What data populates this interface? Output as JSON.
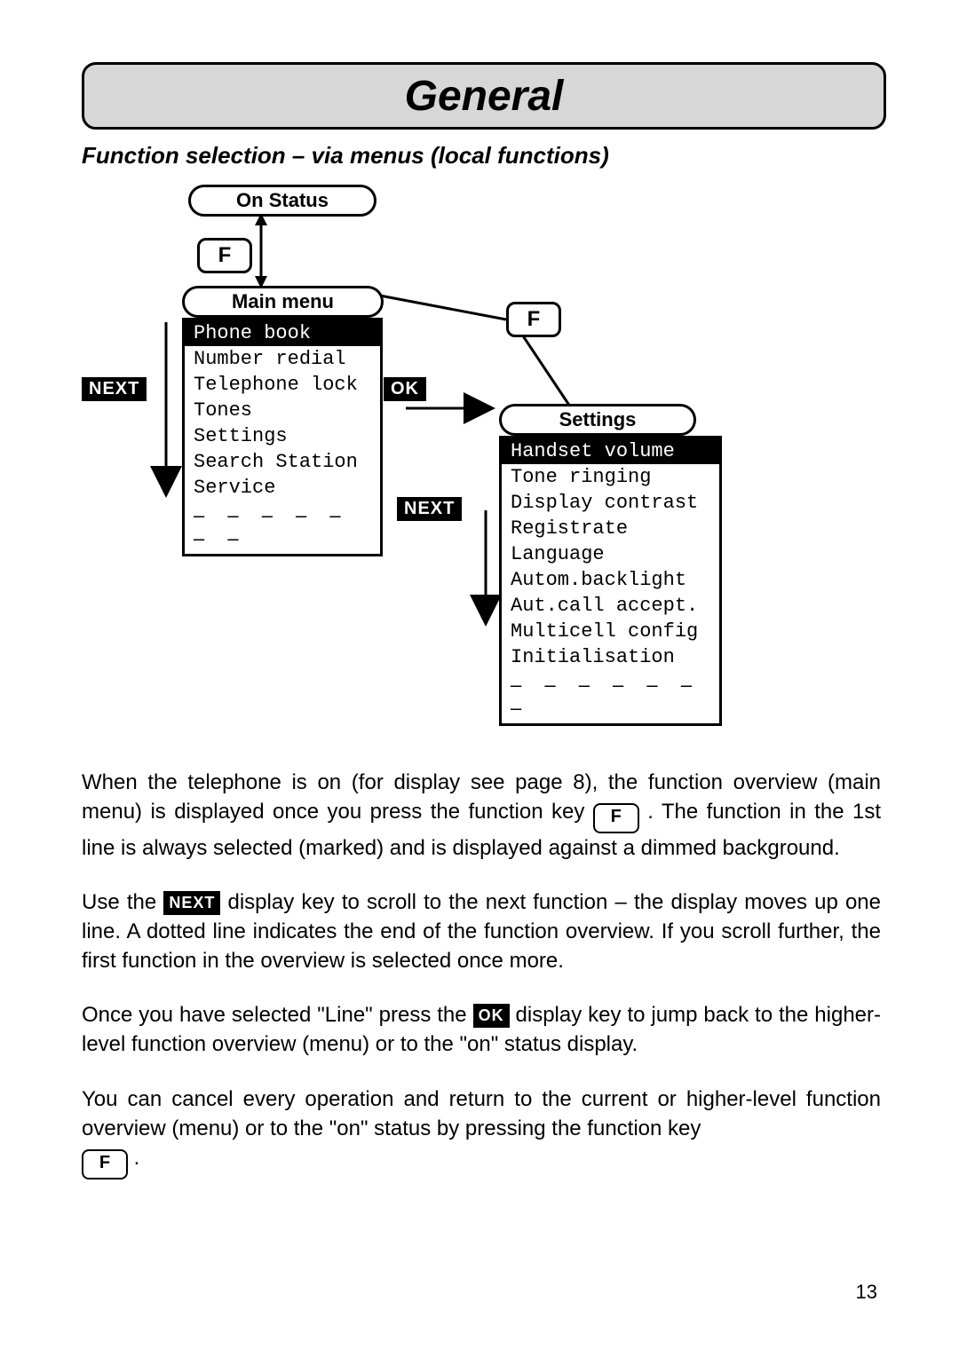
{
  "banner": {
    "title": "General"
  },
  "section_title": "Function selection – via menus (local functions)",
  "diagram": {
    "on_status": "On Status",
    "main_menu_label": "Main menu",
    "settings_label": "Settings",
    "f_key": "F",
    "next_key": "NEXT",
    "ok_key": "OK",
    "main_menu_items": [
      "Phone book",
      "Number redial",
      "Telephone lock",
      "Tones",
      "Settings",
      "Search Station",
      "Service"
    ],
    "main_menu_selected": 0,
    "settings_items": [
      "Handset volume",
      "Tone ringing",
      "Display contrast",
      "Registrate",
      "Language",
      "Autom.backlight",
      "Aut.call accept.",
      "Multicell config",
      "Initialisation"
    ],
    "settings_selected": 0,
    "dots": "– – – – – – –"
  },
  "body": {
    "para1_a": "When the telephone is on (for display see page 8), the function overview (main menu) is displayed once you press the function key ",
    "para1_b": " . The function in the 1st line is always selected (marked) and is displayed against a dimmed background.",
    "para2_a": "Use the ",
    "para2_b": " display key to scroll to the next function – the display moves up one line. A dotted line indicates the end of the function overview. If you scroll further, the first function in the overview is selected once more.",
    "para3_a": "Once you have selected \"Line\" press the ",
    "para3_b": " display key to jump back to the higher-level function overview (menu) or to the \"on\" status display.",
    "para4_a": "You can cancel every operation and return to the current or higher-level function overview (menu) or to the \"on\" status by pressing the function key ",
    "para4_b": " ."
  },
  "page_number": "13"
}
